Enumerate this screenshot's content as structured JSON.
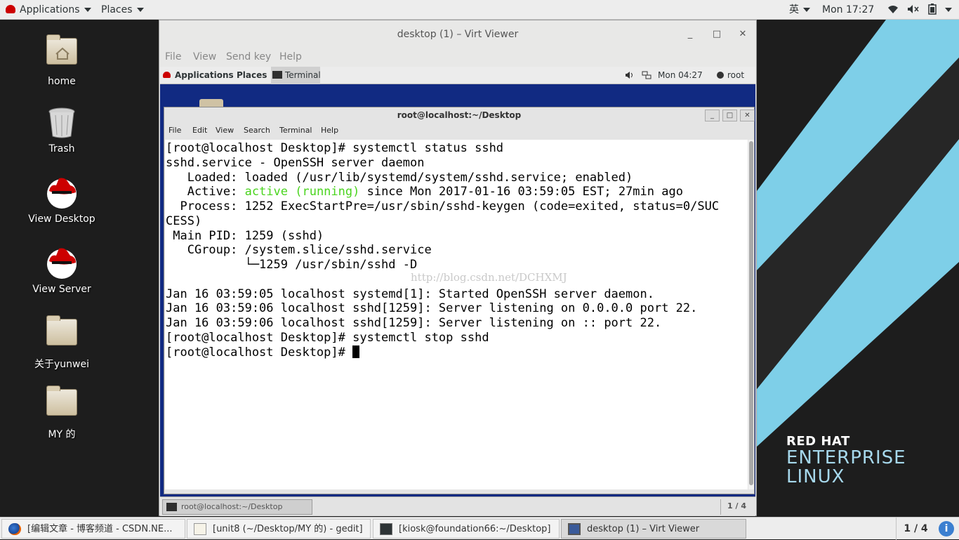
{
  "host_topbar": {
    "applications": "Applications",
    "places": "Places",
    "input_method": "英",
    "clock": "Mon 17:27"
  },
  "desktop_icons": [
    {
      "label": "home"
    },
    {
      "label": "Trash"
    },
    {
      "label": "View Desktop"
    },
    {
      "label": "View Server"
    },
    {
      "label": "关于yunwei"
    },
    {
      "label": "MY 的"
    }
  ],
  "brand": {
    "line1": "RED HAT",
    "line2": "ENTERPRISE",
    "line3": "LINUX"
  },
  "viewer": {
    "title": "desktop (1) – Virt Viewer",
    "menu": [
      "File",
      "View",
      "Send key",
      "Help"
    ]
  },
  "guest": {
    "topbar": {
      "applications": "Applications",
      "places": "Places",
      "task": "Terminal",
      "clock": "Mon 04:27",
      "user": "root"
    },
    "bottom": {
      "task": "root@localhost:~/Desktop",
      "workspace": "1 / 4"
    }
  },
  "terminal": {
    "title": "root@localhost:~/Desktop",
    "menu": [
      "File",
      "Edit",
      "View",
      "Search",
      "Terminal",
      "Help"
    ],
    "lines": [
      "[root@localhost Desktop]# systemctl status sshd",
      "sshd.service - OpenSSH server daemon",
      "   Loaded: loaded (/usr/lib/systemd/system/sshd.service; enabled)",
      {
        "pre": "   Active: ",
        "green": "active (running)",
        "post": " since Mon 2017-01-16 03:59:05 EST; 27min ago"
      },
      "  Process: 1252 ExecStartPre=/usr/sbin/sshd-keygen (code=exited, status=0/SUC",
      "CESS)",
      " Main PID: 1259 (sshd)",
      "   CGroup: /system.slice/sshd.service",
      "           └─1259 /usr/sbin/sshd -D",
      "",
      "Jan 16 03:59:05 localhost systemd[1]: Started OpenSSH server daemon.",
      "Jan 16 03:59:06 localhost sshd[1259]: Server listening on 0.0.0.0 port 22.",
      "Jan 16 03:59:06 localhost sshd[1259]: Server listening on :: port 22.",
      "[root@localhost Desktop]# systemctl stop sshd",
      "[root@localhost Desktop]# "
    ],
    "watermark": "http://blog.csdn.net/DCHXMJ"
  },
  "taskbar": {
    "tasks": [
      {
        "label": "[编辑文章 - 博客频道 - CSDN.NE..."
      },
      {
        "label": "[unit8 (~/Desktop/MY 的) - gedit]"
      },
      {
        "label": "[kiosk@foundation66:~/Desktop]"
      },
      {
        "label": "desktop (1) – Virt Viewer"
      }
    ],
    "workspace": "1 / 4"
  },
  "colors": {
    "terminal_active_green": "#4ad41e",
    "guest_background": "#112a82",
    "brand_stripe": "#7ecfe8"
  }
}
